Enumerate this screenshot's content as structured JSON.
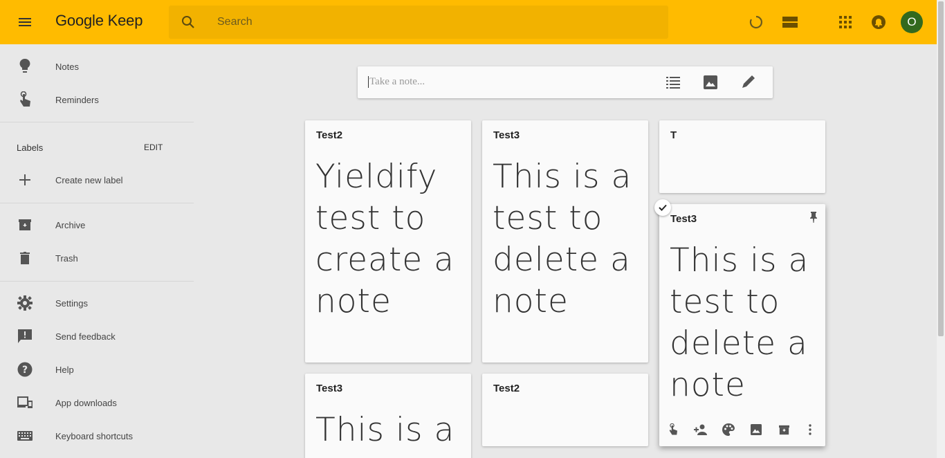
{
  "header": {
    "app_name": "Google Keep",
    "search_placeholder": "Search",
    "avatar_initial": "O",
    "accent_color": "#ffbb00"
  },
  "sidebar": {
    "notes_label": "Notes",
    "reminders_label": "Reminders",
    "labels_heading": "Labels",
    "edit_label": "EDIT",
    "create_label": "Create new label",
    "archive_label": "Archive",
    "trash_label": "Trash",
    "settings_label": "Settings",
    "feedback_label": "Send feedback",
    "help_label": "Help",
    "downloads_label": "App downloads",
    "shortcuts_label": "Keyboard shortcuts"
  },
  "composer": {
    "placeholder": "Take a note..."
  },
  "notes": [
    {
      "title": "Test2",
      "body": "Yieldify test to create a note"
    },
    {
      "title": "Test3",
      "body": "This is a test to delete a note"
    },
    {
      "title": "T",
      "body": ""
    },
    {
      "title": "Test3",
      "body": "This is a test to delete a note"
    },
    {
      "title": "Test3",
      "body": "This is a"
    },
    {
      "title": "Test2",
      "body": ""
    }
  ]
}
